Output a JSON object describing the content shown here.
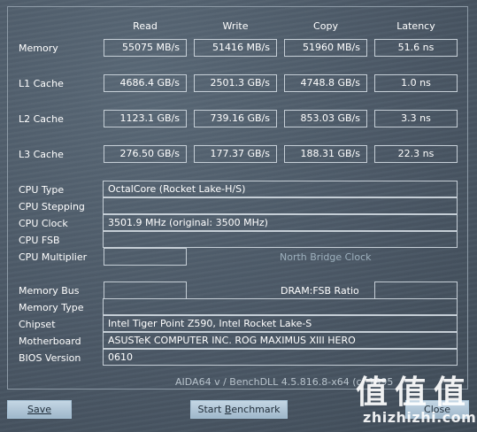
{
  "columns": {
    "read": "Read",
    "write": "Write",
    "copy": "Copy",
    "latency": "Latency"
  },
  "bench_rows": [
    {
      "label": "Memory",
      "read": "55075 MB/s",
      "write": "51416 MB/s",
      "copy": "51960 MB/s",
      "latency": "51.6 ns"
    },
    {
      "label": "L1 Cache",
      "read": "4686.4 GB/s",
      "write": "2501.3 GB/s",
      "copy": "4748.8 GB/s",
      "latency": "1.0 ns"
    },
    {
      "label": "L2 Cache",
      "read": "1123.1 GB/s",
      "write": "739.16 GB/s",
      "copy": "853.03 GB/s",
      "latency": "3.3 ns"
    },
    {
      "label": "L3 Cache",
      "read": "276.50 GB/s",
      "write": "177.37 GB/s",
      "copy": "188.31 GB/s",
      "latency": "22.3 ns"
    }
  ],
  "cpu": {
    "type_label": "CPU Type",
    "type_value": "OctalCore   (Rocket Lake-H/S)",
    "stepping_label": "CPU Stepping",
    "stepping_value": "",
    "clock_label": "CPU Clock",
    "clock_value": "3501.9 MHz  (original: 3500 MHz)",
    "fsb_label": "CPU FSB",
    "fsb_value": "",
    "multiplier_label": "CPU Multiplier",
    "multiplier_value": "",
    "north_bridge_label": "North Bridge Clock",
    "north_bridge_value": ""
  },
  "memory": {
    "bus_label": "Memory Bus",
    "bus_value": "",
    "dram_fsb_label": "DRAM:FSB Ratio",
    "dram_fsb_value": "",
    "type_label": "Memory Type",
    "type_value": ""
  },
  "system": {
    "chipset_label": "Chipset",
    "chipset_value": "Intel Tiger Point Z590, Intel Rocket Lake-S",
    "motherboard_label": "Motherboard",
    "motherboard_value": "ASUSTeK COMPUTER INC. ROG MAXIMUS XIII HERO",
    "bios_label": "BIOS Version",
    "bios_value": "0610"
  },
  "footer": {
    "version_text": "AIDA64 v / BenchDLL 4.5.816.8-x64  (c) 1995"
  },
  "buttons": {
    "save": "Save",
    "start_benchmark_prefix": "Start ",
    "start_benchmark_accel": "B",
    "start_benchmark_suffix": "enchmark",
    "close": "Close"
  },
  "watermark": {
    "chars": [
      "值",
      "值",
      "值"
    ],
    "site": "zhizhizhi.com"
  }
}
